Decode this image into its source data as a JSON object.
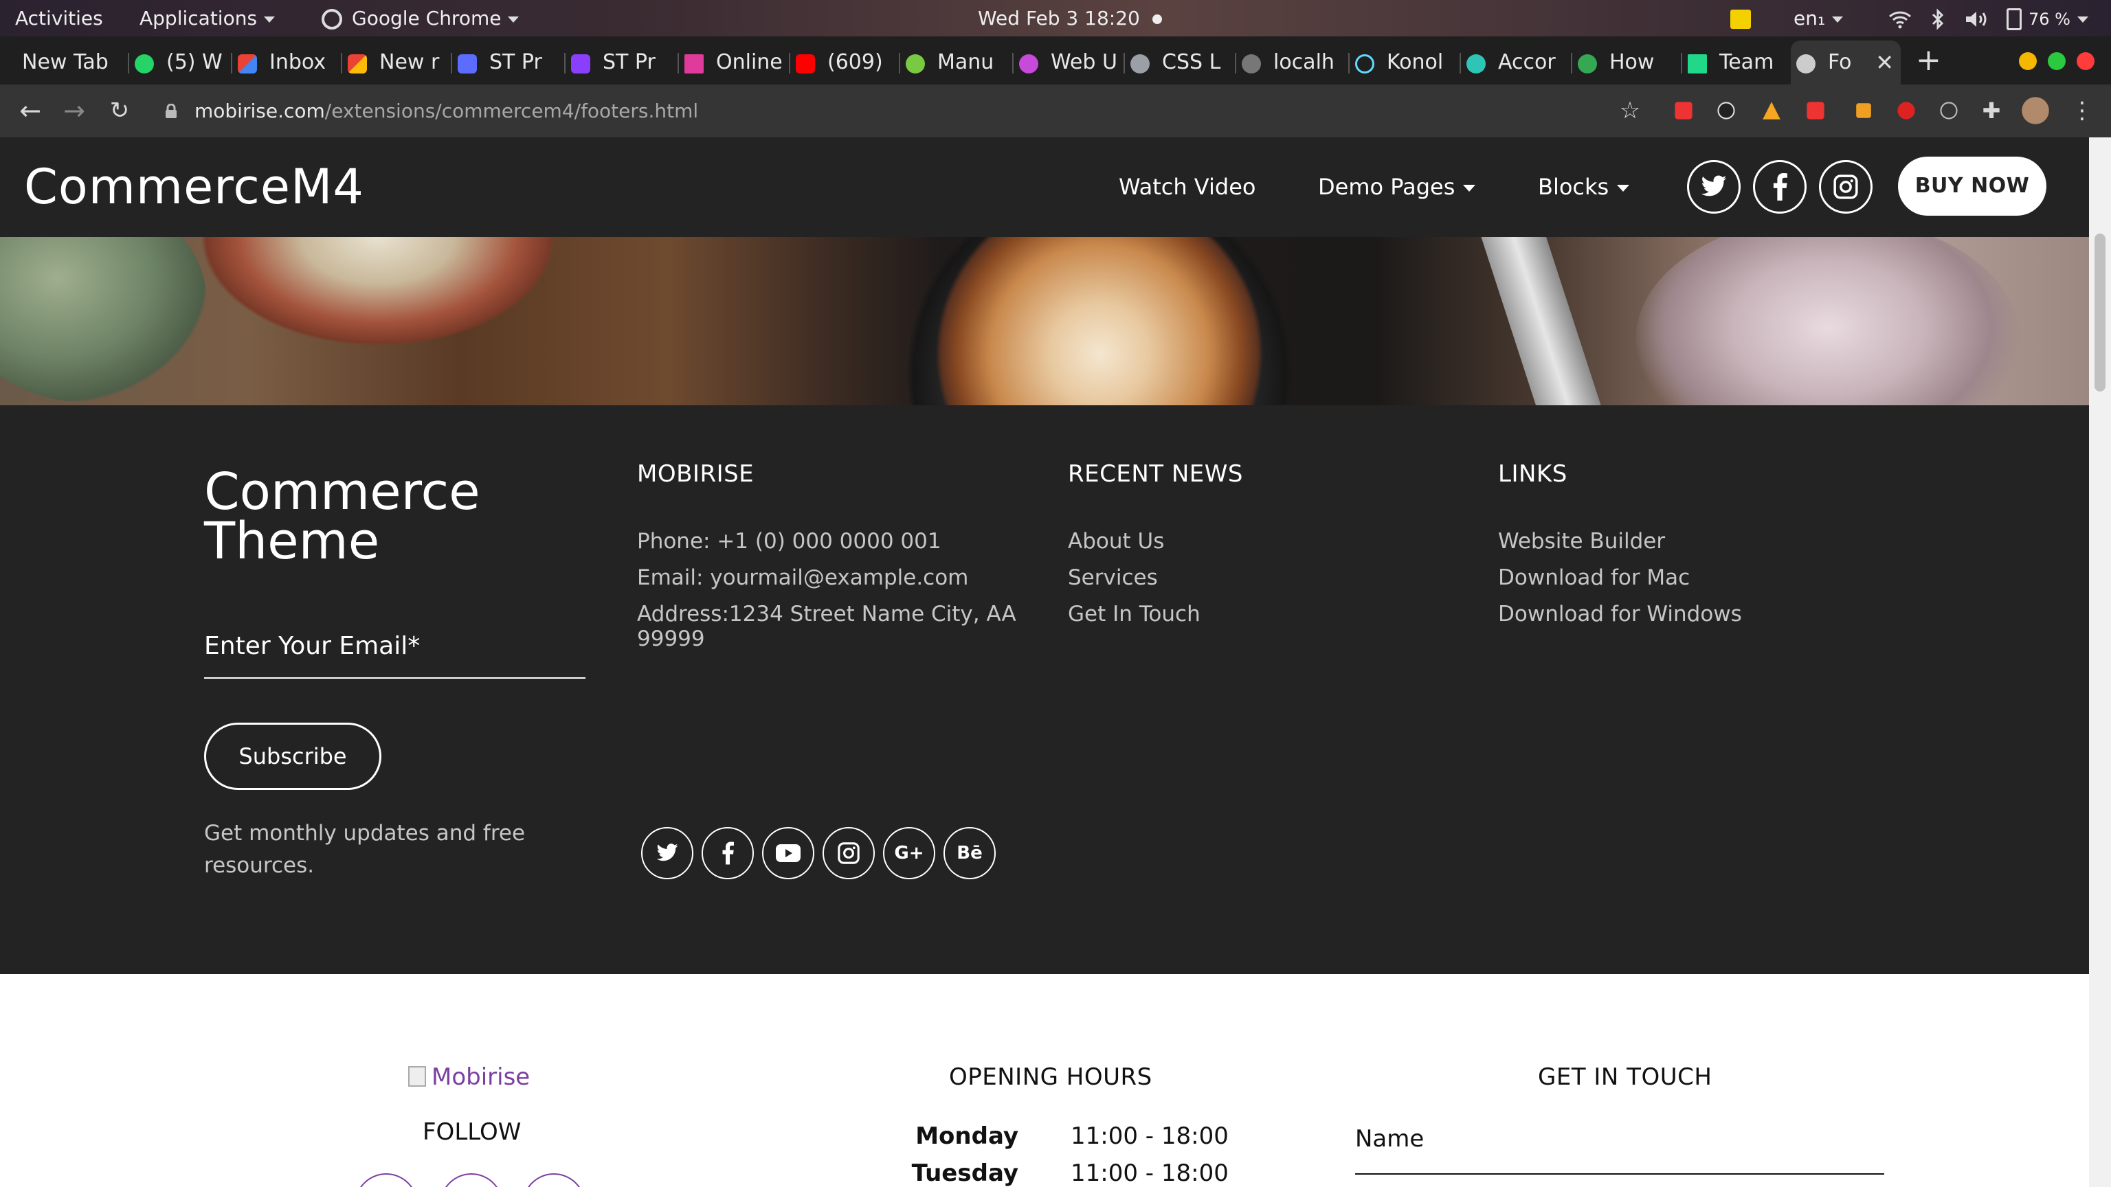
{
  "system_bar": {
    "activities": "Activities",
    "applications": "Applications",
    "app_name": "Google Chrome",
    "datetime": "Wed Feb 3  18:20",
    "lang": "en₁",
    "battery": "76 %"
  },
  "tabs": [
    {
      "label": "New Tab",
      "favicon_color": "#1f1f1f"
    },
    {
      "label": "(5) W",
      "favicon_color": "#25d366"
    },
    {
      "label": "Inbox",
      "favicon_color": "#ea4335"
    },
    {
      "label": "New r",
      "favicon_color": "#ea4335"
    },
    {
      "label": "ST Pr",
      "favicon_color": "#5b6cff"
    },
    {
      "label": "ST Pr",
      "favicon_color": "#8a3ffc"
    },
    {
      "label": "Online",
      "favicon_color": "#e03a9a"
    },
    {
      "label": "(609)",
      "favicon_color": "#ff0000"
    },
    {
      "label": "Manu",
      "favicon_color": "#7ac943"
    },
    {
      "label": "Web U",
      "favicon_color": "#c64bd8"
    },
    {
      "label": "CSS L",
      "favicon_color": "#9aa0a6"
    },
    {
      "label": "localh",
      "favicon_color": "#9aa0a6"
    },
    {
      "label": "Konol",
      "favicon_color": "#61dafb"
    },
    {
      "label": "Accor",
      "favicon_color": "#2ec4b6"
    },
    {
      "label": "How",
      "favicon_color": "#34a853"
    },
    {
      "label": "Team",
      "favicon_color": "#21d789"
    },
    {
      "label": "Fo",
      "favicon_color": "#9aa0a6",
      "active": true
    }
  ],
  "address_bar": {
    "domain": "mobirise.com",
    "path": "/extensions/commercem4/footers.html"
  },
  "site_nav": {
    "brand": "CommerceM4",
    "links": [
      "Watch Video",
      "Demo Pages",
      "Blocks"
    ],
    "buy_label": "BUY NOW",
    "social_icons": [
      "twitter-icon",
      "facebook-icon",
      "instagram-icon"
    ]
  },
  "dark_footer": {
    "title_line1": "Commerce",
    "title_line2": "Theme",
    "email_label": "Enter Your Email*",
    "subscribe_label": "Subscribe",
    "note": "Get monthly updates and free resources.",
    "col1": {
      "heading": "MOBIRISE",
      "phone": "Phone: +1 (0) 000 0000 001",
      "email": "Email: yourmail@example.com",
      "address": "Address:1234 Street Name City, AA 99999",
      "social_icons": [
        "twitter-icon",
        "facebook-icon",
        "youtube-icon",
        "instagram-icon",
        "google-plus-icon",
        "behance-icon"
      ]
    },
    "col2": {
      "heading": "RECENT NEWS",
      "links": [
        "About Us",
        "Services",
        "Get In Touch"
      ]
    },
    "col3": {
      "heading": "LINKS",
      "links": [
        "Website Builder",
        "Download for Mac",
        "Download for Windows"
      ]
    }
  },
  "light_footer": {
    "logo_alt": "Mobirise",
    "follow": "FOLLOW",
    "hours_heading": "OPENING HOURS",
    "hours": [
      {
        "day": "Monday",
        "time": "11:00 - 18:00"
      },
      {
        "day": "Tuesday",
        "time": "11:00 - 18:00"
      }
    ],
    "contact_heading": "GET IN TOUCH",
    "name_label": "Name"
  }
}
